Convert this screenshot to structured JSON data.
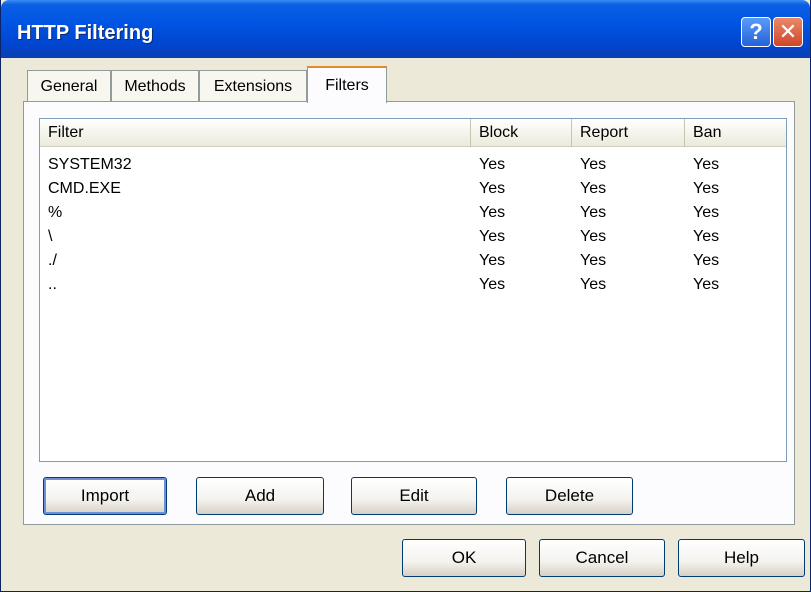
{
  "window": {
    "title": "HTTP Filtering",
    "help_glyph": "?",
    "close_glyph": "✕"
  },
  "tabs": [
    {
      "label": "General"
    },
    {
      "label": "Methods"
    },
    {
      "label": "Extensions"
    },
    {
      "label": "Filters",
      "active": true
    }
  ],
  "table": {
    "columns": [
      "Filter",
      "Block",
      "Report",
      "Ban"
    ],
    "rows": [
      {
        "filter": "SYSTEM32",
        "block": "Yes",
        "report": "Yes",
        "ban": "Yes"
      },
      {
        "filter": "CMD.EXE",
        "block": "Yes",
        "report": "Yes",
        "ban": "Yes"
      },
      {
        "filter": "%",
        "block": "Yes",
        "report": "Yes",
        "ban": "Yes"
      },
      {
        "filter": "\\",
        "block": "Yes",
        "report": "Yes",
        "ban": "Yes"
      },
      {
        "filter": "./",
        "block": "Yes",
        "report": "Yes",
        "ban": "Yes"
      },
      {
        "filter": "..",
        "block": "Yes",
        "report": "Yes",
        "ban": "Yes"
      }
    ]
  },
  "actions": {
    "import": "Import",
    "add": "Add",
    "edit": "Edit",
    "delete": "Delete"
  },
  "footer": {
    "ok": "OK",
    "cancel": "Cancel",
    "help": "Help"
  },
  "colors": {
    "titlebar": "#0054e3",
    "active_tab_accent": "#e68b2c",
    "dialog_bg": "#ece9d8"
  }
}
